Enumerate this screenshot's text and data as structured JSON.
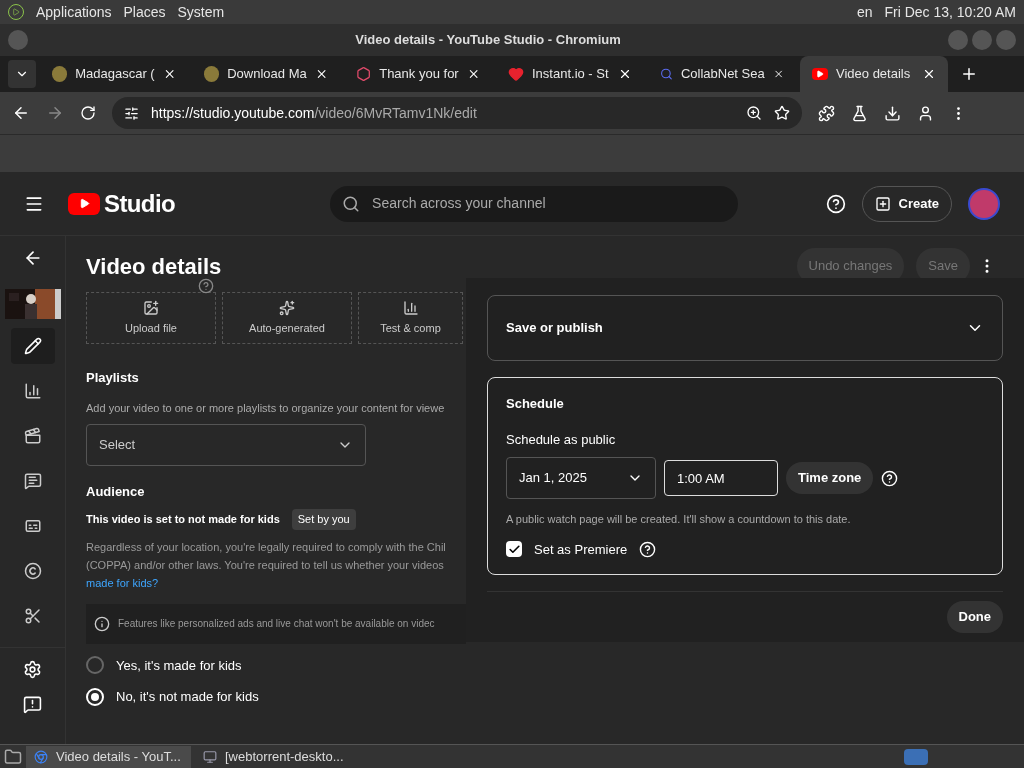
{
  "desktop_panel": {
    "menus": [
      "Applications",
      "Places",
      "System"
    ],
    "language": "en",
    "clock": "Fri Dec 13, 10:20 AM"
  },
  "window": {
    "title": "Video details - YouTube Studio - Chromium"
  },
  "tabs": [
    {
      "label": "Madagascar (",
      "selected": false,
      "kind": "emblem"
    },
    {
      "label": "Download Ma",
      "selected": false,
      "kind": "emblem"
    },
    {
      "label": "Thank you for",
      "selected": false,
      "kind": "hexagon"
    },
    {
      "label": "Instant.io - St",
      "selected": false,
      "kind": "heart"
    },
    {
      "label": "CollabNet Sea",
      "selected": false,
      "kind": "search"
    },
    {
      "label": "Video details",
      "selected": true,
      "kind": "play"
    }
  ],
  "address_bar": {
    "host": "https://studio.youtube.com",
    "path": "/video/6MvRTamv1Nk/edit"
  },
  "studio_header": {
    "logo": "Studio",
    "search_placeholder": "Search across your channel",
    "create_button": "Create"
  },
  "sidebar": {
    "items": [
      {
        "kind": "pencil",
        "selected": true
      },
      {
        "kind": "analytics",
        "selected": false
      },
      {
        "kind": "film",
        "selected": false
      },
      {
        "kind": "comments",
        "selected": false
      },
      {
        "kind": "subtitles",
        "selected": false
      },
      {
        "kind": "copyright",
        "selected": false
      },
      {
        "kind": "scissors",
        "selected": false
      }
    ],
    "bottom_items": [
      {
        "kind": "settings"
      },
      {
        "kind": "feedback"
      }
    ]
  },
  "page": {
    "title": "Video details",
    "undo_button": "Undo changes",
    "save_button": "Save",
    "thumbnail_options": [
      {
        "label": "Upload file",
        "kind": "upload"
      },
      {
        "label": "Auto-generated",
        "kind": "auto"
      },
      {
        "label": "Test & comp",
        "kind": "test"
      }
    ],
    "playlists": {
      "heading": "Playlists",
      "description": "Add your video to one or more playlists to organize your content for viewe",
      "select": "Select"
    },
    "audience": {
      "heading": "Audience",
      "status": "This video is set to not made for kids",
      "badge": "Set by you",
      "description": "Regardless of your location, you're legally required to comply with the Chil (COPPA) and/or other laws. You're required to tell us whether your videos",
      "link": "made for kids?",
      "notice": "Features like personalized ads and live chat won't be available on videc",
      "options": [
        {
          "label": "Yes, it's made for kids",
          "selected": false
        },
        {
          "label": "No, it's not made for kids",
          "selected": true
        }
      ]
    }
  },
  "dialog": {
    "save_section": "Save or publish",
    "schedule": {
      "heading": "Schedule",
      "label": "Schedule as public",
      "date": "Jan 1, 2025",
      "time": "1:00 AM",
      "timezone_button": "Time zone",
      "hint": "A public watch page will be created. It'll show a countdown to this date.",
      "premiere": {
        "label": "Set as Premiere",
        "checked": true
      }
    },
    "done_button": "Done"
  },
  "taskbar": [
    {
      "label": "Video details - YouT...",
      "selected": true
    },
    {
      "label": "[webtorrent-deskto...",
      "selected": false
    }
  ]
}
